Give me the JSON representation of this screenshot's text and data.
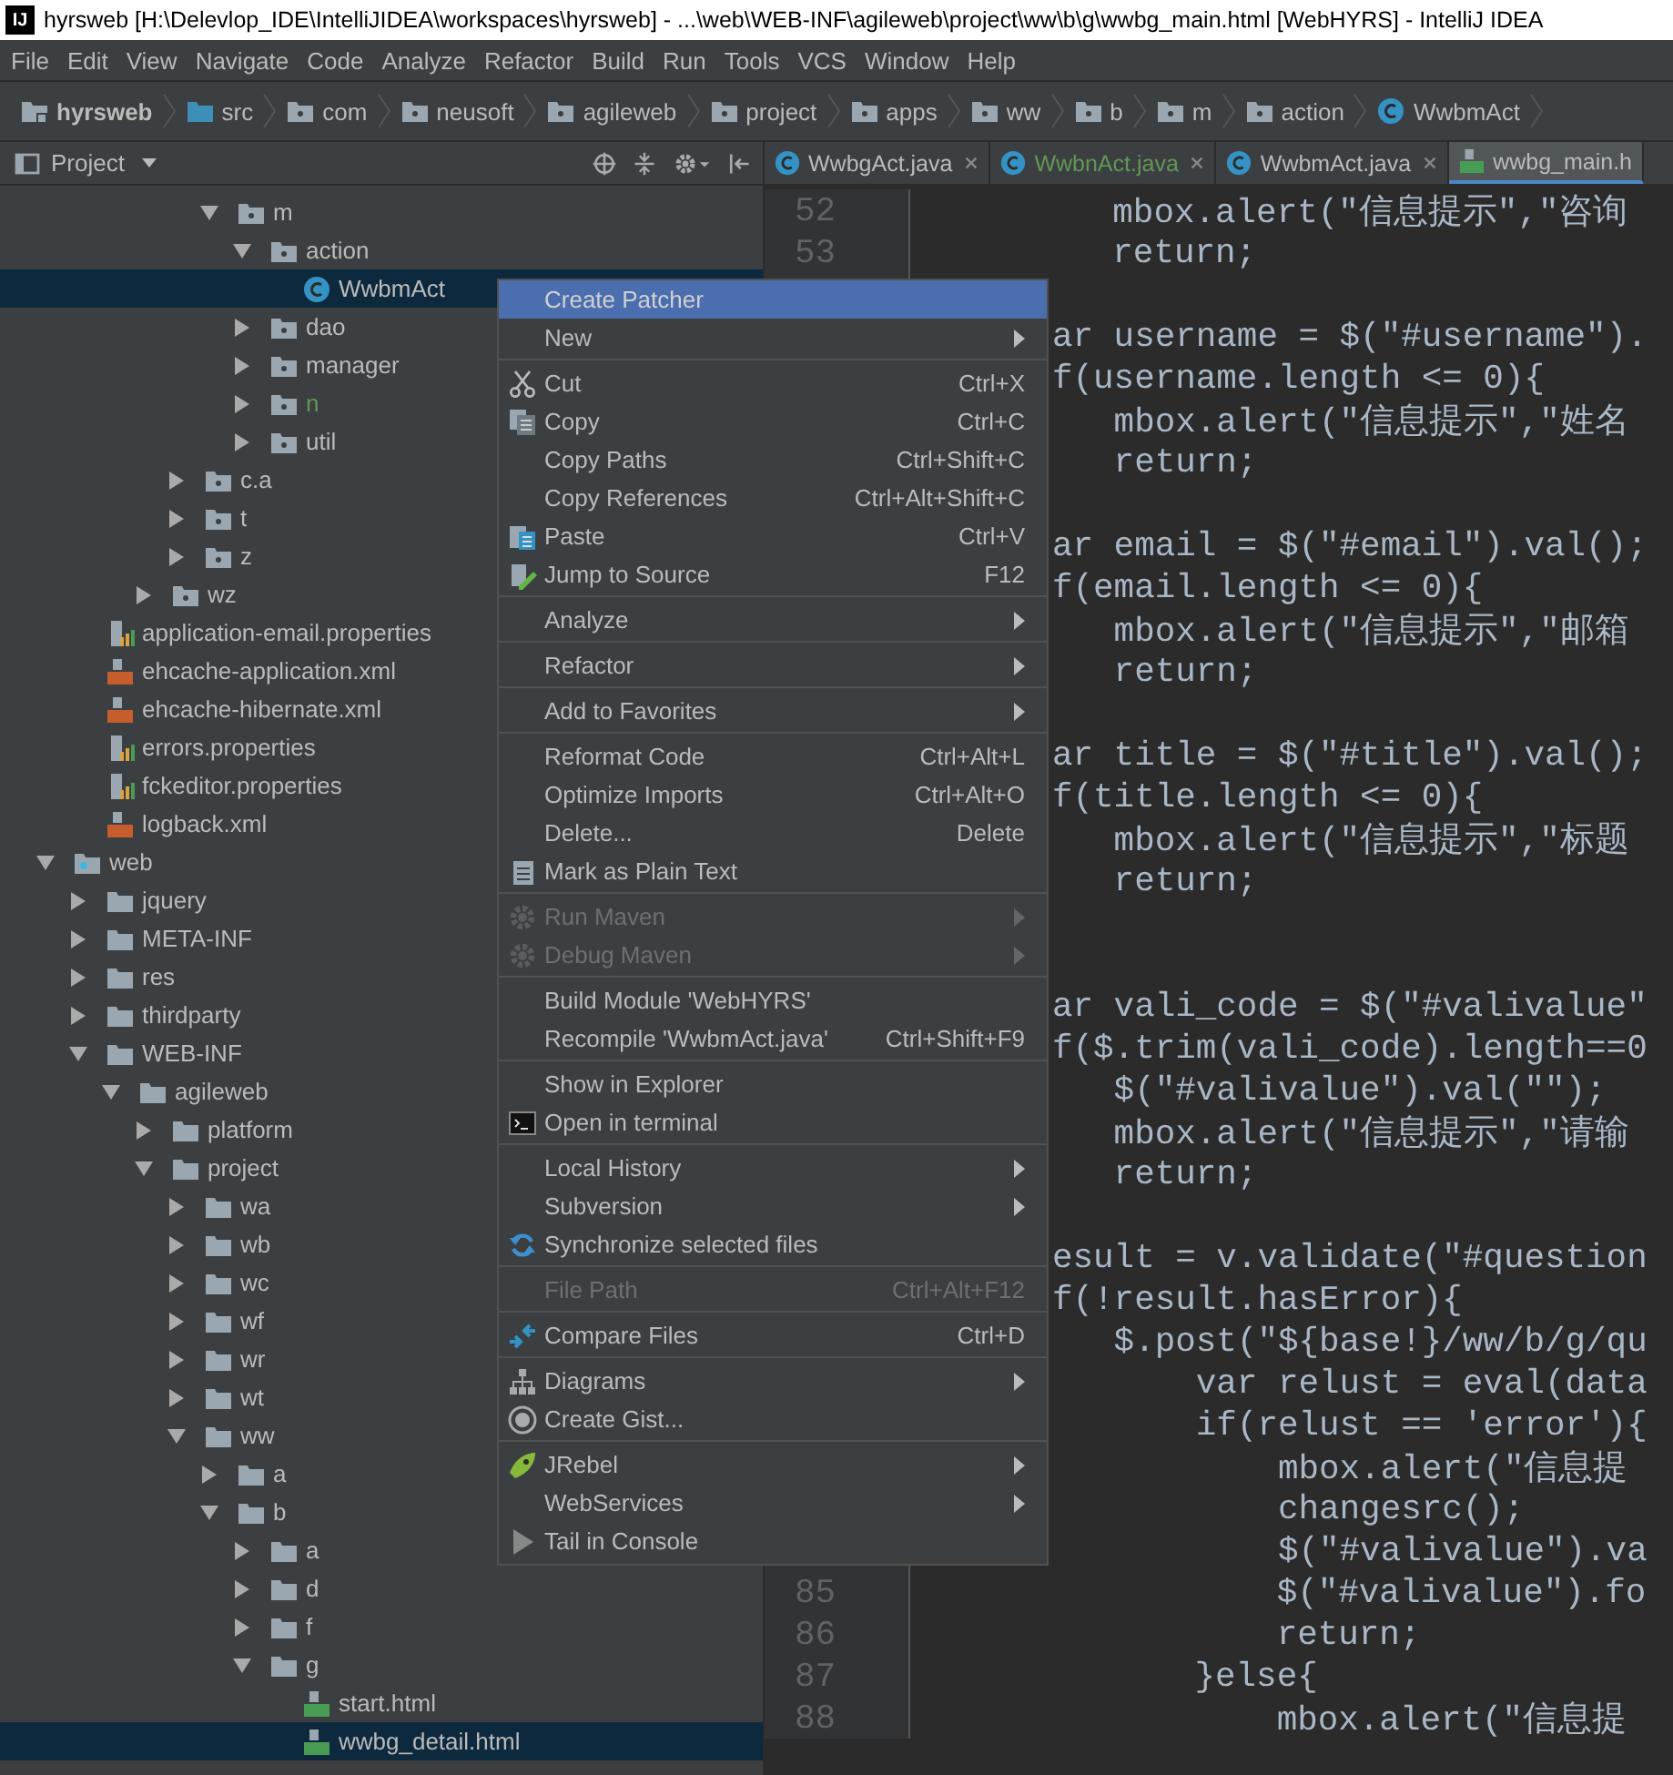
{
  "window": {
    "logo": "IJ",
    "title": "hyrsweb [H:\\Delevlop_IDE\\IntelliJIDEA\\workspaces\\hyrsweb] - ...\\web\\WEB-INF\\agileweb\\project\\ww\\b\\g\\wwbg_main.html [WebHYRS] - IntelliJ IDEA"
  },
  "menu_bar": [
    "File",
    "Edit",
    "View",
    "Navigate",
    "Code",
    "Analyze",
    "Refactor",
    "Build",
    "Run",
    "Tools",
    "VCS",
    "Window",
    "Help"
  ],
  "breadcrumbs": [
    {
      "label": "hyrsweb",
      "kind": "module"
    },
    {
      "label": "src",
      "kind": "source"
    },
    {
      "label": "com",
      "kind": "package"
    },
    {
      "label": "neusoft",
      "kind": "package"
    },
    {
      "label": "agileweb",
      "kind": "package"
    },
    {
      "label": "project",
      "kind": "package"
    },
    {
      "label": "apps",
      "kind": "package"
    },
    {
      "label": "ww",
      "kind": "package"
    },
    {
      "label": "b",
      "kind": "package"
    },
    {
      "label": "m",
      "kind": "package"
    },
    {
      "label": "action",
      "kind": "package"
    },
    {
      "label": "WwbmAct",
      "kind": "class"
    }
  ],
  "project_panel": {
    "title": "Project"
  },
  "tabs": [
    {
      "label": "WwbgAct.java",
      "kind": "class",
      "selected": false
    },
    {
      "label": "WwbnAct.java",
      "kind": "class",
      "selected": false,
      "color": "#629755"
    },
    {
      "label": "WwbmAct.java",
      "kind": "class",
      "selected": false
    },
    {
      "label": "wwbg_main.h",
      "kind": "html",
      "selected": true
    }
  ],
  "tree": [
    {
      "kind": "hidden",
      "children": [
        {
          "kind": "hidden",
          "children": [
            {
              "kind": "hidden",
              "children": [
                {
                  "kind": "hidden",
                  "children": [
                    {
                      "kind": "hidden",
                      "children": [
                        {
                          "kind": "package",
                          "label": "m",
                          "expanded": true,
                          "selected": false,
                          "children": [
                            {
                              "kind": "package",
                              "label": "action",
                              "expanded": true,
                              "selected": false,
                              "children": [
                                {
                                  "kind": "class",
                                  "label": "WwbmAct",
                                  "selected": true
                                }
                              ]
                            },
                            {
                              "kind": "package",
                              "label": "dao",
                              "expanded": false,
                              "selected": false
                            },
                            {
                              "kind": "package",
                              "label": "manager",
                              "expanded": false,
                              "selected": false
                            },
                            {
                              "kind": "package",
                              "label": "n",
                              "expanded": false,
                              "selected": false,
                              "color": "#629755"
                            },
                            {
                              "kind": "package",
                              "label": "util",
                              "expanded": false,
                              "selected": false
                            }
                          ]
                        }
                      ]
                    },
                    {
                      "kind": "package",
                      "label": "c.a",
                      "expanded": false,
                      "selected": false
                    },
                    {
                      "kind": "package",
                      "label": "t",
                      "expanded": false,
                      "selected": false
                    },
                    {
                      "kind": "package",
                      "label": "z",
                      "expanded": false,
                      "selected": false
                    }
                  ]
                },
                {
                  "kind": "package",
                  "label": "wz",
                  "expanded": false,
                  "selected": false
                }
              ]
            }
          ]
        },
        {
          "kind": "properties",
          "label": "application-email.properties",
          "selected": false
        },
        {
          "kind": "xml",
          "label": "ehcache-application.xml",
          "selected": false
        },
        {
          "kind": "xml",
          "label": "ehcache-hibernate.xml",
          "selected": false
        },
        {
          "kind": "properties",
          "label": "errors.properties",
          "selected": false
        },
        {
          "kind": "properties",
          "label": "fckeditor.properties",
          "selected": false
        },
        {
          "kind": "xml",
          "label": "logback.xml",
          "selected": false
        }
      ]
    },
    {
      "kind": "module",
      "label": "web",
      "expanded": true,
      "selected": false,
      "children": [
        {
          "kind": "folder",
          "label": "jquery",
          "expanded": false,
          "selected": false
        },
        {
          "kind": "folder",
          "label": "META-INF",
          "expanded": false,
          "selected": false
        },
        {
          "kind": "folder",
          "label": "res",
          "expanded": false,
          "selected": false
        },
        {
          "kind": "folder",
          "label": "thirdparty",
          "expanded": false,
          "selected": false
        },
        {
          "kind": "folder",
          "label": "WEB-INF",
          "expanded": true,
          "selected": false,
          "children": [
            {
              "kind": "folder",
              "label": "agileweb",
              "expanded": true,
              "selected": false,
              "children": [
                {
                  "kind": "folder",
                  "label": "platform",
                  "expanded": false,
                  "selected": false
                },
                {
                  "kind": "folder",
                  "label": "project",
                  "expanded": true,
                  "selected": false,
                  "children": [
                    {
                      "kind": "folder",
                      "label": "wa",
                      "expanded": false,
                      "selected": false
                    },
                    {
                      "kind": "folder",
                      "label": "wb",
                      "expanded": false,
                      "selected": false
                    },
                    {
                      "kind": "folder",
                      "label": "wc",
                      "expanded": false,
                      "selected": false
                    },
                    {
                      "kind": "folder",
                      "label": "wf",
                      "expanded": false,
                      "selected": false
                    },
                    {
                      "kind": "folder",
                      "label": "wr",
                      "expanded": false,
                      "selected": false
                    },
                    {
                      "kind": "folder",
                      "label": "wt",
                      "expanded": false,
                      "selected": false
                    },
                    {
                      "kind": "folder",
                      "label": "ww",
                      "expanded": true,
                      "selected": false,
                      "children": [
                        {
                          "kind": "folder",
                          "label": "a",
                          "expanded": false,
                          "selected": false
                        },
                        {
                          "kind": "folder",
                          "label": "b",
                          "expanded": true,
                          "selected": false,
                          "children": [
                            {
                              "kind": "folder",
                              "label": "a",
                              "expanded": false,
                              "selected": false
                            },
                            {
                              "kind": "folder",
                              "label": "d",
                              "expanded": false,
                              "selected": false
                            },
                            {
                              "kind": "folder",
                              "label": "f",
                              "expanded": false,
                              "selected": false
                            },
                            {
                              "kind": "folder",
                              "label": "g",
                              "expanded": true,
                              "selected": false,
                              "children": [
                                {
                                  "kind": "html",
                                  "label": "start.html",
                                  "selected": false
                                },
                                {
                                  "kind": "html",
                                  "label": "wwbg_detail.html",
                                  "selected": true
                                }
                              ]
                            }
                          ]
                        }
                      ]
                    }
                  ]
                }
              ]
            }
          ]
        }
      ]
    }
  ],
  "code_lines": [
    {
      "kind": "numbered",
      "number": "52",
      "text": "        mbox.alert(\"信息提示\",\"咨询"
    },
    {
      "kind": "numbered",
      "number": "53",
      "text": "        return;"
    },
    {
      "kind": "blank"
    },
    {
      "kind": "partial",
      "text": "ar username = $(\"#username\")."
    },
    {
      "kind": "partial",
      "text": "f(username.length <= 0){"
    },
    {
      "kind": "partial",
      "text": "   mbox.alert(\"信息提示\",\"姓名"
    },
    {
      "kind": "partial",
      "text": "   return;"
    },
    {
      "kind": "blank"
    },
    {
      "kind": "partial",
      "text": "ar email = $(\"#email\").val();"
    },
    {
      "kind": "partial",
      "text": "f(email.length <= 0){"
    },
    {
      "kind": "partial",
      "text": "   mbox.alert(\"信息提示\",\"邮箱"
    },
    {
      "kind": "partial",
      "text": "   return;"
    },
    {
      "kind": "blank"
    },
    {
      "kind": "partial",
      "text": "ar title = $(\"#title\").val();"
    },
    {
      "kind": "partial",
      "text": "f(title.length <= 0){"
    },
    {
      "kind": "partial",
      "text": "   mbox.alert(\"信息提示\",\"标题"
    },
    {
      "kind": "partial",
      "text": "   return;"
    },
    {
      "kind": "blank"
    },
    {
      "kind": "blank"
    },
    {
      "kind": "partial",
      "text": "ar vali_code = $(\"#valivalue\""
    },
    {
      "kind": "partial",
      "text": "f($.trim(vali_code).length==0"
    },
    {
      "kind": "partial",
      "text": "   $(\"#valivalue\").val(\"\");"
    },
    {
      "kind": "partial",
      "text": "   mbox.alert(\"信息提示\",\"请输"
    },
    {
      "kind": "partial",
      "text": "   return;"
    },
    {
      "kind": "blank"
    },
    {
      "kind": "partial",
      "text": "esult = v.validate(\"#question"
    },
    {
      "kind": "partial",
      "text": "f(!result.hasError){"
    },
    {
      "kind": "partial",
      "text": "   $.post(\"${base!}/ww/b/g/qu"
    },
    {
      "kind": "partial",
      "text": "       var relust = eval(data"
    },
    {
      "kind": "partial",
      "text": "       if(relust == 'error'){"
    },
    {
      "kind": "partial",
      "text": "           mbox.alert(\"信息提"
    },
    {
      "kind": "partial",
      "text": "           changesrc();"
    },
    {
      "kind": "partial",
      "text": "           $(\"#valivalue\").va"
    },
    {
      "kind": "numbered",
      "number": "85",
      "text": "                $(\"#valivalue\").fo"
    },
    {
      "kind": "numbered",
      "number": "86",
      "text": "                return;"
    },
    {
      "kind": "numbered",
      "number": "87",
      "text": "            }else{"
    },
    {
      "kind": "numbered",
      "number": "88",
      "text": "                mbox.alert(\"信息提"
    }
  ],
  "context_menu": [
    {
      "kind": "item",
      "label": "Create Patcher",
      "selected": true,
      "disabled": false,
      "submenu": false
    },
    {
      "kind": "item",
      "label": "New",
      "selected": false,
      "disabled": false,
      "submenu": true
    },
    {
      "kind": "separator"
    },
    {
      "kind": "item",
      "label": "Cut",
      "shortcut": "Ctrl+X",
      "selected": false,
      "disabled": false,
      "submenu": false
    },
    {
      "kind": "item",
      "label": "Copy",
      "shortcut": "Ctrl+C",
      "selected": false,
      "disabled": false,
      "submenu": false
    },
    {
      "kind": "item",
      "label": "Copy Paths",
      "shortcut": "Ctrl+Shift+C",
      "selected": false,
      "disabled": false,
      "submenu": false
    },
    {
      "kind": "item",
      "label": "Copy References",
      "shortcut": "Ctrl+Alt+Shift+C",
      "selected": false,
      "disabled": false,
      "submenu": false
    },
    {
      "kind": "item",
      "label": "Paste",
      "shortcut": "Ctrl+V",
      "selected": false,
      "disabled": false,
      "submenu": false
    },
    {
      "kind": "item",
      "label": "Jump to Source",
      "shortcut": "F12",
      "selected": false,
      "disabled": false,
      "submenu": false
    },
    {
      "kind": "separator"
    },
    {
      "kind": "item",
      "label": "Analyze",
      "selected": false,
      "disabled": false,
      "submenu": true
    },
    {
      "kind": "separator"
    },
    {
      "kind": "item",
      "label": "Refactor",
      "selected": false,
      "disabled": false,
      "submenu": true
    },
    {
      "kind": "separator"
    },
    {
      "kind": "item",
      "label": "Add to Favorites",
      "selected": false,
      "disabled": false,
      "submenu": true
    },
    {
      "kind": "separator"
    },
    {
      "kind": "item",
      "label": "Reformat Code",
      "shortcut": "Ctrl+Alt+L",
      "selected": false,
      "disabled": false,
      "submenu": false
    },
    {
      "kind": "item",
      "label": "Optimize Imports",
      "shortcut": "Ctrl+Alt+O",
      "selected": false,
      "disabled": false,
      "submenu": false
    },
    {
      "kind": "item",
      "label": "Delete...",
      "shortcut": "Delete",
      "selected": false,
      "disabled": false,
      "submenu": false
    },
    {
      "kind": "item",
      "label": "Mark as Plain Text",
      "selected": false,
      "disabled": false,
      "submenu": false
    },
    {
      "kind": "separator"
    },
    {
      "kind": "item",
      "label": "Run Maven",
      "selected": false,
      "disabled": true,
      "submenu": true
    },
    {
      "kind": "item",
      "label": "Debug Maven",
      "selected": false,
      "disabled": true,
      "submenu": true
    },
    {
      "kind": "separator"
    },
    {
      "kind": "item",
      "label": "Build Module 'WebHYRS'",
      "selected": false,
      "disabled": false,
      "submenu": false
    },
    {
      "kind": "item",
      "label": "Recompile 'WwbmAct.java'",
      "shortcut": "Ctrl+Shift+F9",
      "selected": false,
      "disabled": false,
      "submenu": false
    },
    {
      "kind": "separator"
    },
    {
      "kind": "item",
      "label": "Show in Explorer",
      "selected": false,
      "disabled": false,
      "submenu": false
    },
    {
      "kind": "item",
      "label": "Open in terminal",
      "selected": false,
      "disabled": false,
      "submenu": false
    },
    {
      "kind": "separator"
    },
    {
      "kind": "item",
      "label": "Local History",
      "selected": false,
      "disabled": false,
      "submenu": true
    },
    {
      "kind": "item",
      "label": "Subversion",
      "selected": false,
      "disabled": false,
      "submenu": true
    },
    {
      "kind": "item",
      "label": "Synchronize selected files",
      "selected": false,
      "disabled": false,
      "submenu": false
    },
    {
      "kind": "separator"
    },
    {
      "kind": "item",
      "label": "File Path",
      "shortcut": "Ctrl+Alt+F12",
      "selected": false,
      "disabled": true,
      "submenu": false
    },
    {
      "kind": "separator"
    },
    {
      "kind": "item",
      "label": "Compare Files",
      "shortcut": "Ctrl+D",
      "selected": false,
      "disabled": false,
      "submenu": false
    },
    {
      "kind": "separator"
    },
    {
      "kind": "item",
      "label": "Diagrams",
      "selected": false,
      "disabled": false,
      "submenu": true
    },
    {
      "kind": "item",
      "label": "Create Gist...",
      "selected": false,
      "disabled": false,
      "submenu": false
    },
    {
      "kind": "separator"
    },
    {
      "kind": "item",
      "label": "JRebel",
      "selected": false,
      "disabled": false,
      "submenu": true
    },
    {
      "kind": "item",
      "label": "WebServices",
      "selected": false,
      "disabled": false,
      "submenu": true
    },
    {
      "kind": "item",
      "label": "Tail in Console",
      "selected": false,
      "disabled": false,
      "submenu": false
    }
  ]
}
